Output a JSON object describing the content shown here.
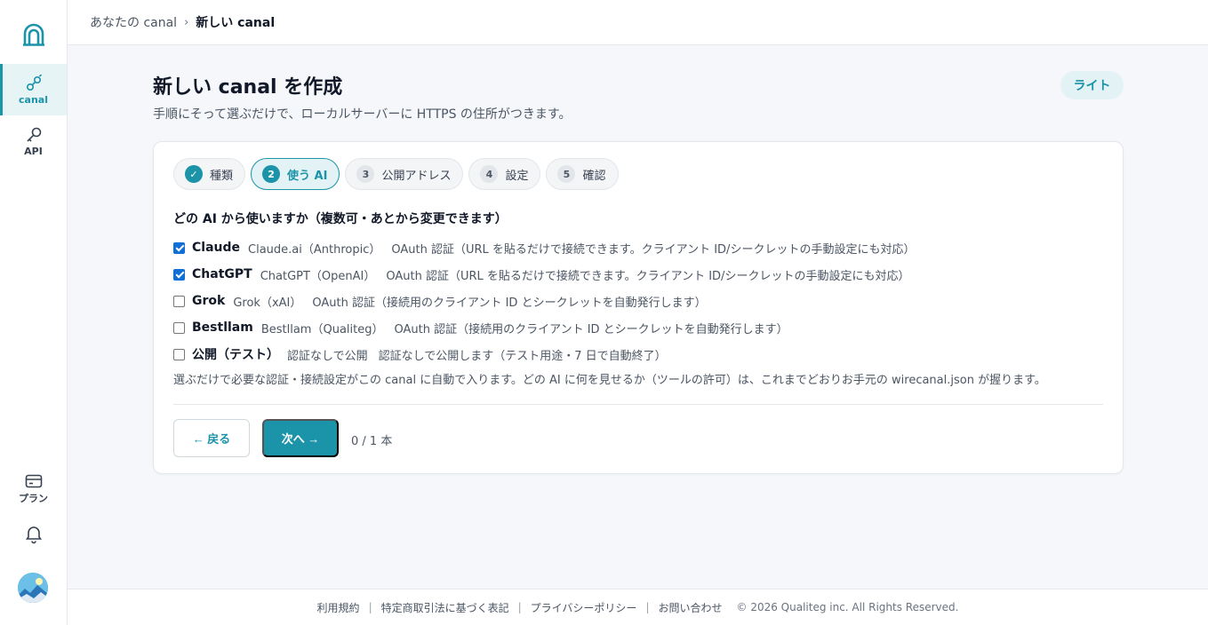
{
  "sidebar": {
    "logo_icon": "arch-logo-icon",
    "items": [
      {
        "label": "canal",
        "icon": "link-icon",
        "active": true
      },
      {
        "label": "API",
        "icon": "key-icon",
        "active": false
      },
      {
        "label": "プラン",
        "icon": "card-icon",
        "active": false
      }
    ],
    "bell_icon": "bell-icon"
  },
  "breadcrumb": {
    "parent": "あなたの canal",
    "separator": "›",
    "current": "新しい canal"
  },
  "page": {
    "title": "新しい canal を作成",
    "subtitle": "手順にそって選ぶだけで、ローカルサーバーに HTTPS の住所がつきます。",
    "mode_badge": "ライト"
  },
  "steps": [
    {
      "num": "✓",
      "label": "種類",
      "state": "done"
    },
    {
      "num": "2",
      "label": "使う AI",
      "state": "current"
    },
    {
      "num": "3",
      "label": "公開アドレス",
      "state": "todo"
    },
    {
      "num": "4",
      "label": "設定",
      "state": "todo"
    },
    {
      "num": "5",
      "label": "確認",
      "state": "todo"
    }
  ],
  "question": "どの AI から使いますか（複数可・あとから変更できます）",
  "options": [
    {
      "name": "Claude",
      "provider": "Claude.ai（Anthropic）",
      "desc": "OAuth 認証（URL を貼るだけで接続できます。クライアント ID/シークレットの手動設定にも対応）",
      "checked": true
    },
    {
      "name": "ChatGPT",
      "provider": "ChatGPT（OpenAI）",
      "desc": "OAuth 認証（URL を貼るだけで接続できます。クライアント ID/シークレットの手動設定にも対応）",
      "checked": true
    },
    {
      "name": "Grok",
      "provider": "Grok（xAI）",
      "desc": "OAuth 認証（接続用のクライアント ID とシークレットを自動発行します）",
      "checked": false
    },
    {
      "name": "Bestllam",
      "provider": "Bestllam（Qualiteg）",
      "desc": "OAuth 認証（接続用のクライアント ID とシークレットを自動発行します）",
      "checked": false
    },
    {
      "name": "公開（テスト）",
      "provider": "認証なしで公開",
      "desc": "認証なしで公開します（テスト用途・7 日で自動終了）",
      "checked": false
    }
  ],
  "note": "選ぶだけで必要な認証・接続設定がこの canal に自動で入ります。どの AI に何を見せるか（ツールの許可）は、これまでどおりお手元の wirecanal.json が握ります。",
  "actions": {
    "back": "← 戻る",
    "next": "次へ →",
    "count": "0 / 1 本"
  },
  "footer": {
    "links": [
      "利用規約",
      "特定商取引法に基づく表記",
      "プライバシーポリシー",
      "お問い合わせ"
    ],
    "copyright": "© 2026 Qualiteg inc. All Rights Reserved."
  },
  "colors": {
    "accent": "#1b93a8",
    "accent_light": "#e3f3f5",
    "checkbox": "#0f6fd6"
  }
}
